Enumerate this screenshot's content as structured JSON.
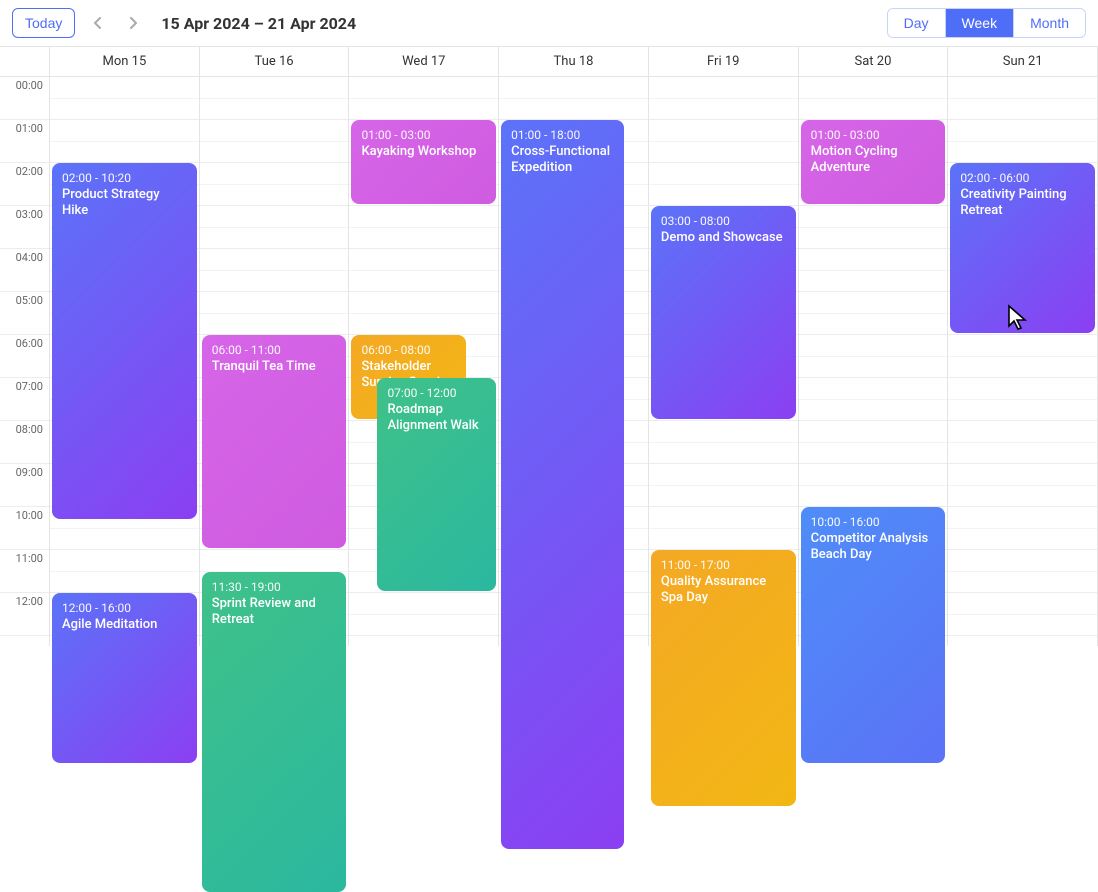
{
  "toolbar": {
    "today_label": "Today",
    "date_range": "15 Apr 2024 – 21 Apr 2024",
    "views": {
      "day": "Day",
      "week": "Week",
      "month": "Month"
    },
    "active_view": "week"
  },
  "hours": [
    "00:00",
    "01:00",
    "02:00",
    "03:00",
    "04:00",
    "05:00",
    "06:00",
    "07:00",
    "08:00",
    "09:00",
    "10:00",
    "11:00",
    "12:00"
  ],
  "hour_height": 43,
  "days": [
    "Mon 15",
    "Tue 16",
    "Wed 17",
    "Thu 18",
    "Fri 19",
    "Sat 20",
    "Sun 21"
  ],
  "events": [
    {
      "day": 0,
      "start": 2,
      "end": 10.33,
      "time": "02:00 - 10:20",
      "title": "Product Strategy Hike",
      "cls": "grad-purple"
    },
    {
      "day": 0,
      "start": 12,
      "end": 16,
      "time": "12:00 - 16:00",
      "title": "Agile Meditation",
      "cls": "grad-purple"
    },
    {
      "day": 1,
      "start": 6,
      "end": 11,
      "time": "06:00 - 11:00",
      "title": "Tranquil Tea Time",
      "cls": "grad-pink"
    },
    {
      "day": 1,
      "start": 11.5,
      "end": 19,
      "time": "11:30 - 19:00",
      "title": "Sprint Review and Retreat",
      "cls": "grad-green"
    },
    {
      "day": 2,
      "start": 1,
      "end": 3,
      "time": "01:00 - 03:00",
      "title": "Kayaking Workshop",
      "cls": "grad-pink"
    },
    {
      "day": 2,
      "start": 6,
      "end": 8,
      "time": "06:00 - 08:00",
      "title": "Stakeholder Sunrise Session",
      "cls": "grad-orange",
      "shrinkLeft": true
    },
    {
      "day": 2,
      "start": 7,
      "end": 12,
      "time": "07:00 - 12:00",
      "title": "Roadmap Alignment Walk",
      "cls": "grad-green",
      "shiftRight": true
    },
    {
      "day": 3,
      "start": 1,
      "end": 18,
      "time": "01:00 - 18:00",
      "title": "Cross-Functional Expedition",
      "cls": "grad-purple",
      "narrow": true
    },
    {
      "day": 4,
      "start": 3,
      "end": 8,
      "time": "03:00 - 08:00",
      "title": "Demo and Showcase",
      "cls": "grad-purple"
    },
    {
      "day": 4,
      "start": 11,
      "end": 17,
      "time": "11:00 - 17:00",
      "title": "Quality Assurance Spa Day",
      "cls": "grad-orange"
    },
    {
      "day": 5,
      "start": 1,
      "end": 3,
      "time": "01:00 - 03:00",
      "title": "Motion Cycling Adventure",
      "cls": "grad-pink"
    },
    {
      "day": 5,
      "start": 10,
      "end": 16,
      "time": "10:00 - 16:00",
      "title": "Competitor Analysis Beach Day",
      "cls": "grad-blue"
    },
    {
      "day": 6,
      "start": 2,
      "end": 6,
      "time": "02:00 - 06:00",
      "title": "Creativity Painting Retreat",
      "cls": "grad-purple"
    }
  ]
}
